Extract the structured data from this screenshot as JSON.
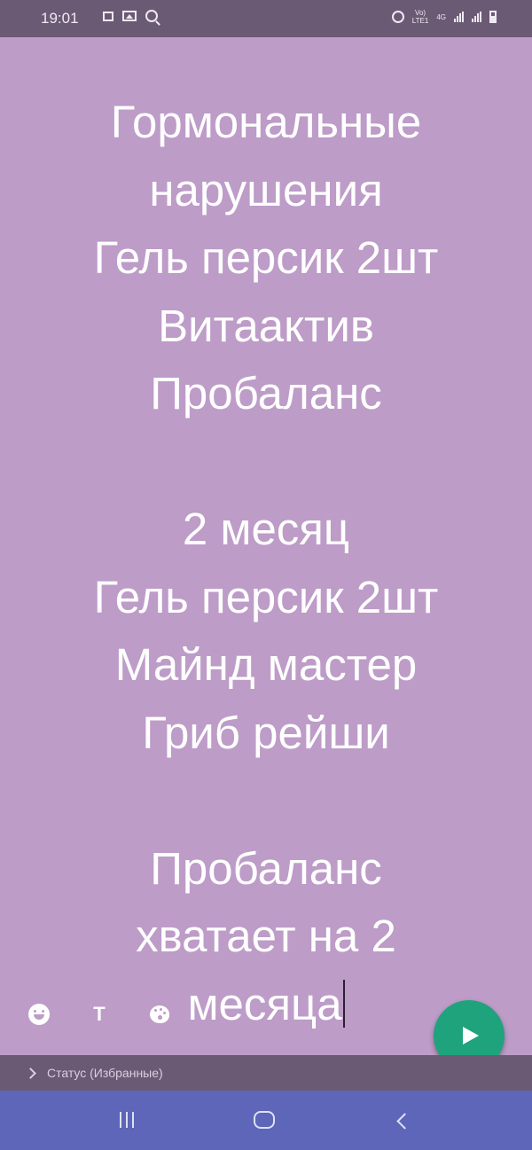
{
  "status_bar": {
    "time": "19:01",
    "network_label_top": "Vo)",
    "network_label_bottom": "LTE1",
    "network_type": "4G"
  },
  "editor": {
    "lines": [
      "Гормональные",
      "нарушения",
      "Гель персик 2шт",
      "Витаактив",
      "Пробаланс",
      "",
      "2 месяц",
      "Гель персик 2шт",
      "Майнд мастер",
      "Гриб рейши",
      "",
      "Пробаланс",
      "хватает на 2",
      "месяца"
    ],
    "background_color": "#bd9cc8",
    "text_color": "#ffffff"
  },
  "toolbar": {
    "emoji_icon": "emoji-icon",
    "text_label": "T",
    "palette_icon": "palette-icon"
  },
  "send_button": {
    "icon": "send-icon",
    "color": "#1fa37d"
  },
  "status_audience": {
    "label": "Статус (Избранные)"
  }
}
